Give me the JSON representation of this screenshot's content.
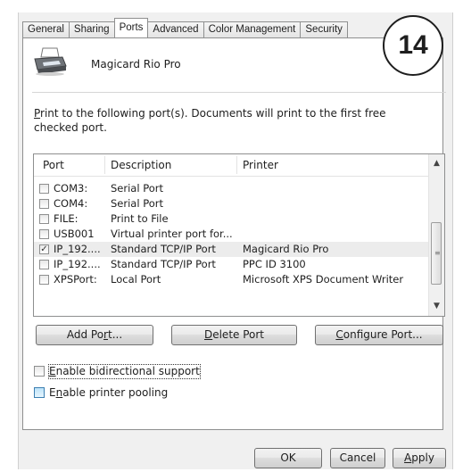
{
  "tabs": [
    "General",
    "Sharing",
    "Ports",
    "Advanced",
    "Color Management",
    "Security"
  ],
  "active_tab": "Ports",
  "badge": "14",
  "printer_name": "Magicard Rio Pro",
  "instruction": {
    "access_key": "P",
    "rest": "rint to the following port(s). Documents will print to the first free checked port."
  },
  "columns": [
    "Port",
    "Description",
    "Printer"
  ],
  "ports": [
    {
      "checked": false,
      "port": "COM3:",
      "description": "Serial Port",
      "printer": ""
    },
    {
      "checked": false,
      "port": "COM4:",
      "description": "Serial Port",
      "printer": ""
    },
    {
      "checked": false,
      "port": "FILE:",
      "description": "Print to File",
      "printer": ""
    },
    {
      "checked": false,
      "port": "USB001",
      "description": "Virtual printer port for...",
      "printer": ""
    },
    {
      "checked": true,
      "port": "IP_192....",
      "description": "Standard TCP/IP Port",
      "printer": "Magicard Rio Pro"
    },
    {
      "checked": false,
      "port": "IP_192....",
      "description": "Standard TCP/IP Port",
      "printer": "PPC ID 3100"
    },
    {
      "checked": false,
      "port": "XPSPort:",
      "description": "Local Port",
      "printer": "Microsoft XPS Document Writer"
    }
  ],
  "buttons": {
    "add_port": {
      "pre": "Add Po",
      "key": "r",
      "post": "t..."
    },
    "delete_port": {
      "pre": "",
      "key": "D",
      "post": "elete Port"
    },
    "configure_port": {
      "pre": "",
      "key": "C",
      "post": "onfigure Port..."
    },
    "ok": "OK",
    "cancel": "Cancel",
    "apply": {
      "pre": "",
      "key": "A",
      "post": "pply"
    }
  },
  "options": {
    "bidirectional": {
      "key": "E",
      "rest": "nable bidirectional support",
      "checked": false
    },
    "pooling": {
      "pre": "E",
      "key": "n",
      "rest": "able printer pooling",
      "checked": false
    }
  },
  "icons": {
    "printer": "printer-icon",
    "scroll_up": "scroll-up-arrow-icon",
    "scroll_down": "scroll-down-arrow-icon"
  }
}
